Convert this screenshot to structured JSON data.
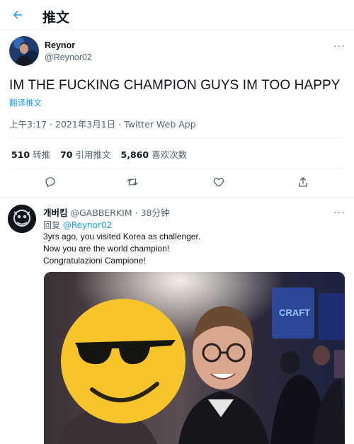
{
  "header": {
    "title": "推文",
    "back_icon": "arrow-left-icon"
  },
  "tweet": {
    "author_name": "Reynor",
    "author_handle": "@Reynor02",
    "text": "IM THE FUCKING CHAMPION GUYS IM TOO HAPPY",
    "translate_label": "翻译推文",
    "meta": "上午3:17 · 2021年3月1日 · Twitter Web App",
    "more_label": "···",
    "stats": [
      {
        "count": "510",
        "label": "转推"
      },
      {
        "count": "70",
        "label": "引用推文"
      },
      {
        "count": "5,860",
        "label": "喜欢次数"
      }
    ],
    "actions": [
      "reply-icon",
      "retweet-icon",
      "like-icon",
      "share-icon"
    ]
  },
  "reply": {
    "name": "개버킴",
    "handle": "@GABBERKIM",
    "time": "· 38分钟",
    "replying_prefix": "回复",
    "replying_to": "@Reynor02",
    "lines": [
      "3yrs ago, you visited Korea as challenger.",
      "Now you are the world champion!",
      "Congratulazioni Campione!"
    ],
    "more_label": "···"
  },
  "colors": {
    "accent": "#1d9bf0",
    "secondary_text": "#536471",
    "emoji_yellow": "#f7c52a"
  }
}
